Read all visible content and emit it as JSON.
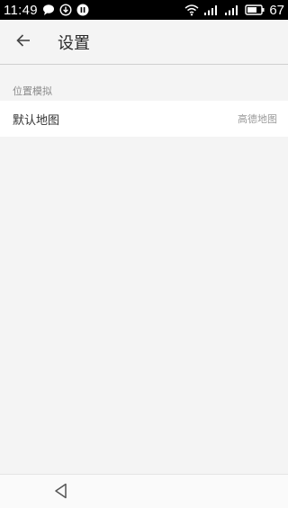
{
  "status_bar": {
    "time": "11:49",
    "battery_percent": "67",
    "icons": [
      "chat-bubble-icon",
      "download-icon",
      "pause-icon",
      "wifi-icon",
      "signal-icon",
      "signal-icon",
      "battery-icon"
    ]
  },
  "app_bar": {
    "back_icon": "arrow-left-icon",
    "title": "设置"
  },
  "sections": [
    {
      "header": "位置模拟",
      "items": [
        {
          "label": "默认地图",
          "value": "高德地图"
        }
      ]
    }
  ],
  "nav_bar": {
    "back_icon": "triangle-back-icon"
  },
  "colors": {
    "background": "#f4f4f4",
    "status_bar": "#000000",
    "row_background": "#ffffff"
  }
}
